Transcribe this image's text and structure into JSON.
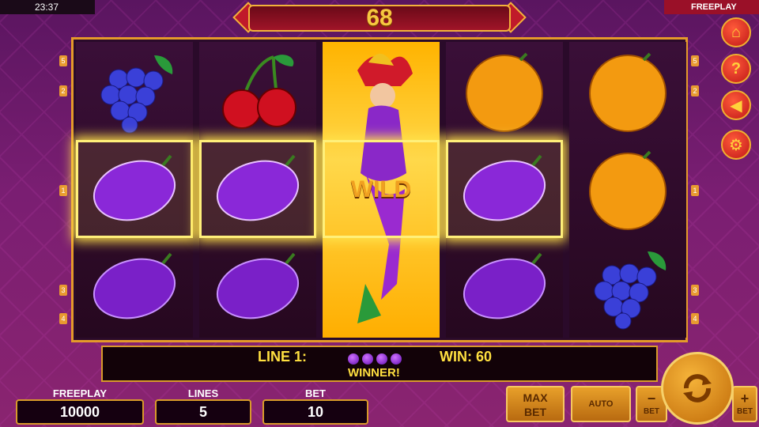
{
  "topbar": {
    "clock": "23:37",
    "mode": "FREEPLAY"
  },
  "banner": {
    "value": "68"
  },
  "reels": [
    {
      "symbols": [
        "grapes",
        "plum",
        "plum"
      ],
      "wins": [
        false,
        true,
        false
      ]
    },
    {
      "symbols": [
        "cherries",
        "plum",
        "plum"
      ],
      "wins": [
        false,
        true,
        false
      ]
    },
    {
      "symbols": [
        "wild-joker",
        "wild-joker",
        "wild-joker"
      ],
      "wins": [
        false,
        true,
        false
      ],
      "wild_text": "WILD"
    },
    {
      "symbols": [
        "orange",
        "plum",
        "plum"
      ],
      "wins": [
        false,
        true,
        false
      ]
    },
    {
      "symbols": [
        "orange",
        "orange",
        "grapes"
      ],
      "wins": [
        false,
        false,
        false
      ]
    }
  ],
  "paylines": {
    "left": [
      "5",
      "2",
      "1",
      "3",
      "4"
    ],
    "right": [
      "5",
      "2",
      "1",
      "3",
      "4"
    ]
  },
  "sidebar": {
    "icons": [
      "home-icon",
      "help-icon",
      "sound-icon",
      "settings-icon"
    ],
    "labels": [
      "⌂",
      "?",
      "◀",
      "⚙"
    ]
  },
  "info": {
    "line_label": "LINE 1:",
    "win_label": "WIN: 60",
    "status": "WINNER!",
    "symbol_count": 4
  },
  "footer": {
    "freeplay_label": "FREEPLAY",
    "freeplay_value": "10000",
    "lines_label": "LINES",
    "lines_value": "5",
    "bet_label": "BET",
    "bet_value": "10",
    "maxbet_line1": "MAX",
    "maxbet_line2": "BET",
    "auto_label": "AUTO",
    "bet_minus_label": "BET",
    "bet_minus_symbol": "−",
    "bet_plus_label": "BET",
    "bet_plus_symbol": "+"
  },
  "colors": {
    "accent": "#e59a2a",
    "win_text": "#ffe040",
    "plum": "#7a20c8"
  }
}
